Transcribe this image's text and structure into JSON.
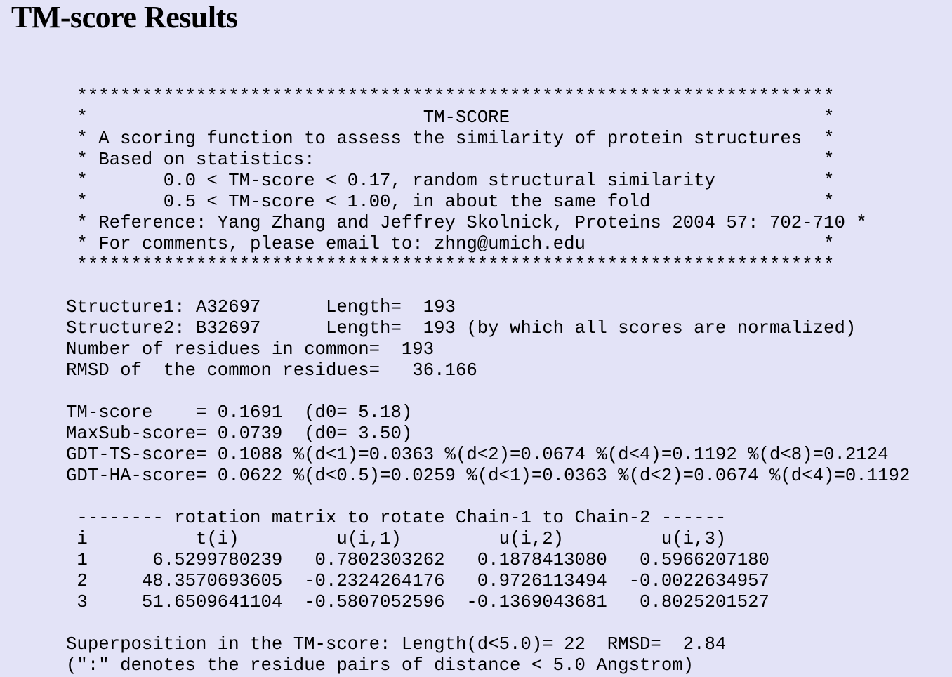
{
  "page": {
    "title": "TM-score Results"
  },
  "output": {
    "lines": [
      " **********************************************************************",
      " *                               TM-SCORE                             *",
      " * A scoring function to assess the similarity of protein structures  *",
      " * Based on statistics:                                               *",
      " *       0.0 < TM-score < 0.17, random structural similarity          *",
      " *       0.5 < TM-score < 1.00, in about the same fold                *",
      " * Reference: Yang Zhang and Jeffrey Skolnick, Proteins 2004 57: 702-710 *",
      " * For comments, please email to: zhng@umich.edu                      *",
      " **********************************************************************",
      "",
      "Structure1: A32697      Length=  193",
      "Structure2: B32697      Length=  193 (by which all scores are normalized)",
      "Number of residues in common=  193",
      "RMSD of  the common residues=   36.166",
      "",
      "TM-score    = 0.1691  (d0= 5.18)",
      "MaxSub-score= 0.0739  (d0= 3.50)",
      "GDT-TS-score= 0.1088 %(d<1)=0.0363 %(d<2)=0.0674 %(d<4)=0.1192 %(d<8)=0.2124",
      "GDT-HA-score= 0.0622 %(d<0.5)=0.0259 %(d<1)=0.0363 %(d<2)=0.0674 %(d<4)=0.1192",
      "",
      " -------- rotation matrix to rotate Chain-1 to Chain-2 ------",
      " i          t(i)         u(i,1)         u(i,2)         u(i,3)",
      " 1      6.5299780239   0.7802303262   0.1878413080   0.5966207180",
      " 2     48.3570693605  -0.2324264176   0.9726113494  -0.0022634957",
      " 3     51.6509641104  -0.5807052596  -0.1369043681   0.8025201527",
      "",
      "Superposition in the TM-score: Length(d<5.0)= 22  RMSD=  2.84",
      "(\":\" denotes the residue pairs of distance < 5.0 Angstrom)"
    ]
  }
}
